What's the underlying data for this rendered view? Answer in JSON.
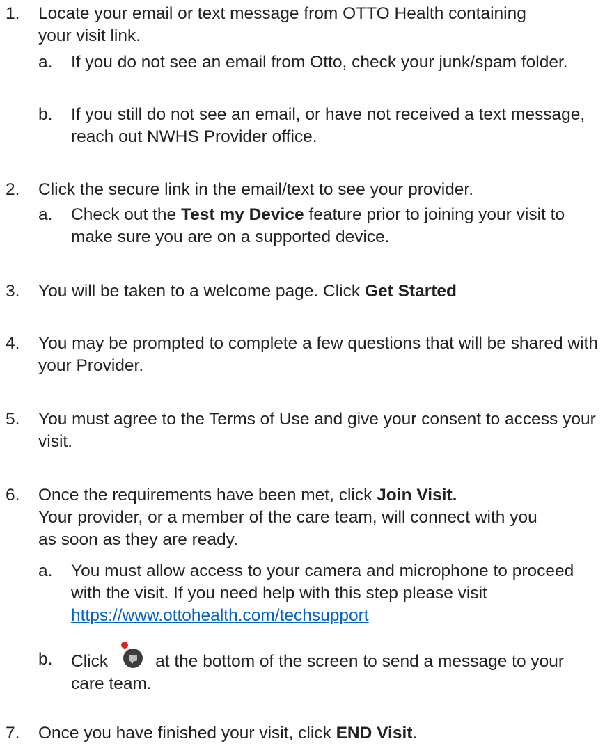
{
  "steps": [
    {
      "num": "1.",
      "text": "Locate your email or text message from OTTO Health containing your visit link.",
      "subs": [
        {
          "letter": "a.",
          "text": "If you do not see an email from Otto, check your junk/spam folder."
        },
        {
          "letter": "b.",
          "text": "If you still do not see an email, or have not received a text message, reach out NWHS Provider office."
        }
      ]
    },
    {
      "num": "2.",
      "text": "Click the secure link in the email/text to see your provider.",
      "subs": [
        {
          "letter": "a.",
          "pre": "Check out the ",
          "bold": "Test my Device",
          "post": " feature prior to joining your visit to make sure you are on a supported device."
        }
      ]
    },
    {
      "num": "3.",
      "pre": "You will be taken to a welcome page. Click ",
      "bold": "Get Started"
    },
    {
      "num": "4.",
      "text": "You may be prompted to complete a few questions that will be shared with your Provider."
    },
    {
      "num": "5.",
      "text": "You must agree to the Terms of Use and give your consent to access your visit."
    },
    {
      "num": "6.",
      "pre": "Once the requirements have been met, click ",
      "bold": "Join Visit.",
      "post": "Your provider, or a member of the care team, will connect with you as soon as they are ready.",
      "subs": [
        {
          "letter": "a.",
          "text": "You must allow access to your camera and microphone to proceed with the visit. If you need help with this step please visit ",
          "link": "https://www.ottohealth.com/techsupport"
        },
        {
          "letter": "b.",
          "pre": "Click",
          "icon": "chat-icon",
          "post": "at the bottom of the screen to send a message to your care team."
        }
      ]
    },
    {
      "num": "7.",
      "pre": "Once you have finished your visit, click ",
      "bold": "END Visit",
      "post": "."
    }
  ]
}
